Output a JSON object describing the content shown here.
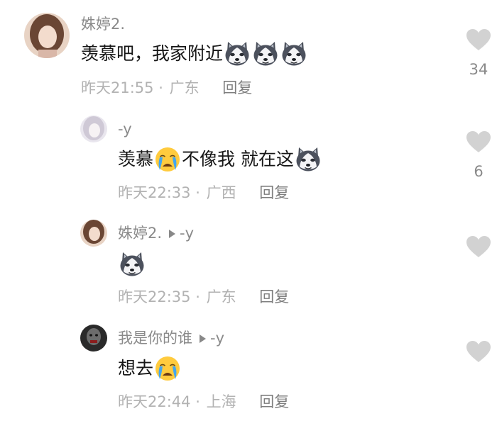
{
  "comments": [
    {
      "username": "姝婷2.",
      "text_before": "羡慕吧，我家附近",
      "emojis": [
        "husky-icon",
        "husky-icon",
        "husky-icon"
      ],
      "time": "昨天21:55",
      "location": "广东",
      "reply_label": "回复",
      "likes": "34"
    },
    {
      "username": "-y",
      "text_before": "羡慕",
      "emoji_mid": "crying-icon",
      "text_after": "不像我 就在这",
      "emoji_end": "husky-icon",
      "time": "昨天22:33",
      "location": "广西",
      "reply_label": "回复",
      "likes": "6"
    },
    {
      "username": "姝婷2.",
      "reply_to": "-y",
      "emoji": "husky-icon",
      "time": "昨天22:35",
      "location": "广东",
      "reply_label": "回复",
      "likes": ""
    },
    {
      "username": "我是你的谁",
      "reply_to": "-y",
      "text_before": "想去",
      "emoji": "crying-icon",
      "time": "昨天22:44",
      "location": "上海",
      "reply_label": "回复",
      "likes": ""
    }
  ],
  "separator": "·",
  "colors": {
    "text": "#161616",
    "username": "#8a8a8a",
    "meta": "#b2b2b2",
    "heart": "#d2d2d2"
  }
}
